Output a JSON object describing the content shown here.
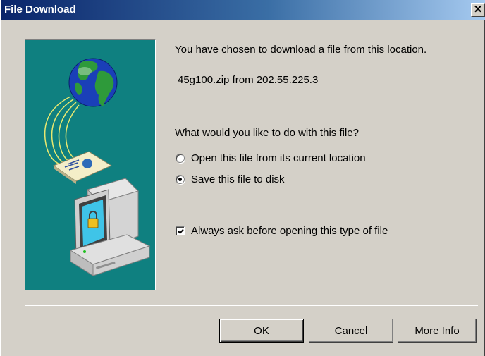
{
  "window": {
    "title": "File Download",
    "close_symbol": "✕"
  },
  "illustration": {
    "icons": [
      "globe-icon",
      "document-icon",
      "computer-lock-icon"
    ],
    "background_color": "#0f8080"
  },
  "message": {
    "intro": "You have chosen to download a file from this location.",
    "file_source": "45g100.zip from 202.55.225.3",
    "question": "What would you like to do with this file?"
  },
  "options": [
    {
      "label": "Open this file from its current location",
      "selected": false
    },
    {
      "label": "Save this file to disk",
      "selected": true
    }
  ],
  "always_ask": {
    "label": "Always ask before opening this type of file",
    "checked": true
  },
  "buttons": {
    "ok": "OK",
    "cancel": "Cancel",
    "more_info": "More Info"
  }
}
